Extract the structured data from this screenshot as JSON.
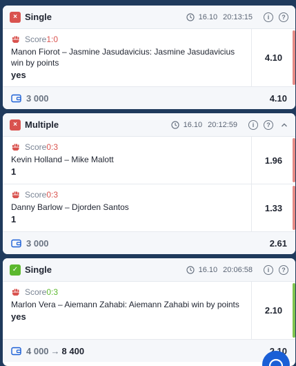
{
  "bets": [
    {
      "type": "Single",
      "status": "lost",
      "date": "16.10",
      "time": "20:13:15",
      "events": [
        {
          "score_label": "Score",
          "score": "1:0",
          "name": "Manon Fiorot – Jasmine Jasudavicius: Jasmine Jasudavicius win by points",
          "outcome": "yes",
          "odds": "4.10"
        }
      ],
      "stake": "3 000",
      "payout": "",
      "total_odds": "4.10"
    },
    {
      "type": "Multiple",
      "status": "lost",
      "date": "16.10",
      "time": "20:12:59",
      "events": [
        {
          "score_label": "Score",
          "score": "0:3",
          "name": "Kevin Holland – Mike Malott",
          "outcome": "1",
          "odds": "1.96"
        },
        {
          "score_label": "Score",
          "score": "0:3",
          "name": "Danny Barlow – Djorden Santos",
          "outcome": "1",
          "odds": "1.33"
        }
      ],
      "stake": "3 000",
      "payout": "",
      "total_odds": "2.61"
    },
    {
      "type": "Single",
      "status": "won",
      "date": "16.10",
      "time": "20:06:58",
      "events": [
        {
          "score_label": "Score",
          "score": "0:3",
          "name": "Marlon Vera – Aiemann Zahabi: Aiemann Zahabi win by points",
          "outcome": "yes",
          "odds": "2.10"
        }
      ],
      "stake": "4 000",
      "payout": "8 400",
      "total_odds": "2.10"
    }
  ],
  "icons": {
    "lost_mark": "×",
    "won_mark": "✓",
    "info": "i",
    "help": "?",
    "arrow": "→"
  },
  "colors": {
    "lost": "#d9534f",
    "won": "#5cb82e",
    "background": "#1f3a5c",
    "chat_button": "#1a5fd6"
  }
}
